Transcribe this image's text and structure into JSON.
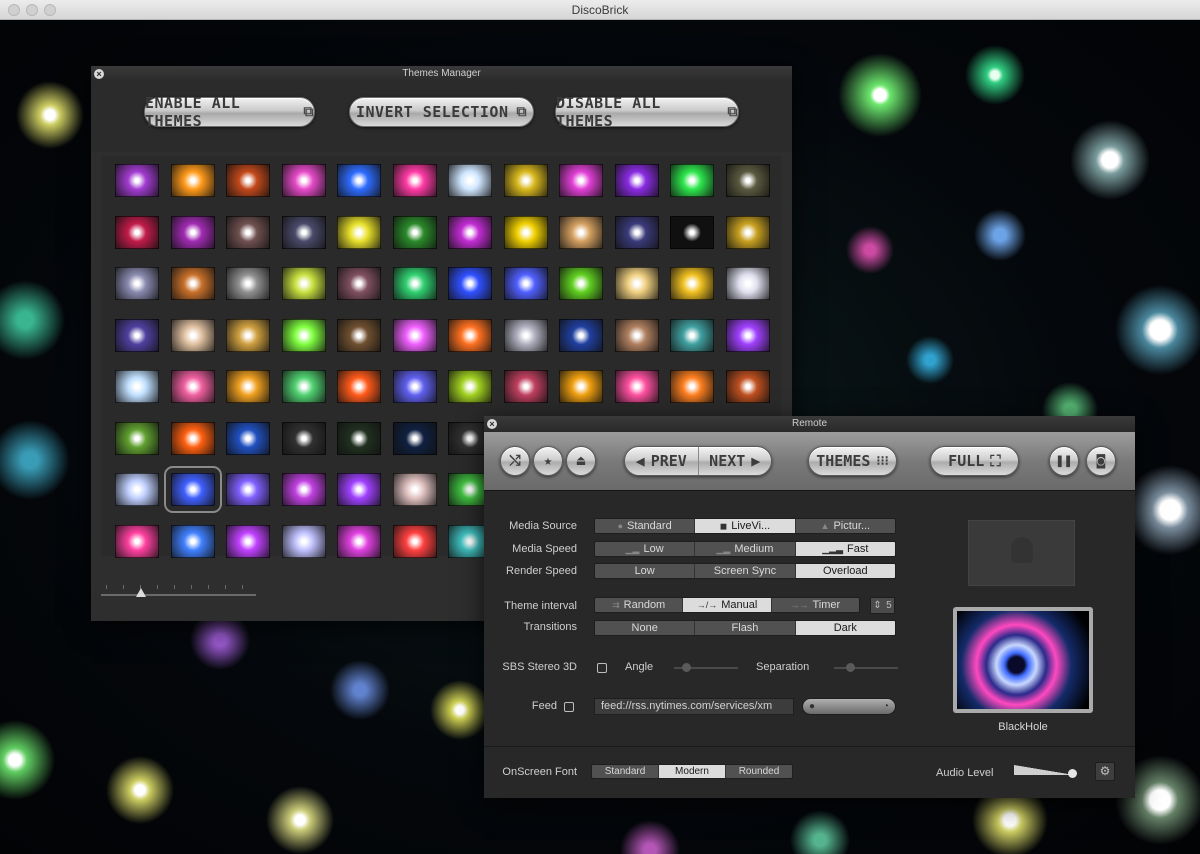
{
  "window": {
    "title": "DiscoBrick"
  },
  "themes_manager": {
    "title": "Themes Manager",
    "buttons": {
      "enable_all": "ENABLE ALL THEMES",
      "invert_selection": "INVERT SELECTION",
      "disable_all": "DISABLE ALL THEMES"
    },
    "thumbnail_colors": [
      [
        "#a23bd1",
        "#ff9a1a",
        "#c2481a",
        "#e64ac8",
        "#2e6cff",
        "#ff3aa5",
        "#cfe6ff",
        "#d8b81d",
        "#e13fd6",
        "#8a2be2",
        "#2de64c",
        "#5a5a40"
      ],
      [
        "#c21b4a",
        "#a12bb3",
        "#705050",
        "#4a4a6a",
        "#e8e02a",
        "#2a8a2a",
        "#c22cd4",
        "#f0d000",
        "#d4a060",
        "#3a3a7a",
        "#101010",
        "#c8a020"
      ],
      [
        "#8a8ab0",
        "#c8702a",
        "#909090",
        "#c8e040",
        "#805060",
        "#30d070",
        "#3050ff",
        "#5060ff",
        "#60d020",
        "#f0d080",
        "#f0c020",
        "#e0e0f0"
      ],
      [
        "#5040a0",
        "#e0c0a0",
        "#d0a040",
        "#80ff40",
        "#705030",
        "#f060ff",
        "#ff7020",
        "#b0b0c0",
        "#2040a0",
        "#b08060",
        "#40a0a0",
        "#a040ff"
      ],
      [
        "#c0e0ff",
        "#f060a0",
        "#f0a020",
        "#50d070",
        "#ff5a1a",
        "#6060f0",
        "#a0d020",
        "#c04060",
        "#f0a010",
        "#ff50a0",
        "#ff8020",
        "#c05020"
      ],
      [
        "#60a030",
        "#ff6010",
        "#2050c0",
        "#303030",
        "#203020",
        "#102040",
        "#303030",
        "#000000",
        "#000000",
        "#000000",
        "#000000",
        "#000000"
      ],
      [
        "#c0d0ff",
        "#4060ff",
        "#8060ff",
        "#c040e0",
        "#a040ff",
        "#e0c0c0",
        "#40c040",
        "#000000",
        "#000000",
        "#000000",
        "#000000",
        "#000000"
      ],
      [
        "#ff40a0",
        "#4080ff",
        "#c040ff",
        "#c0c0ff",
        "#e040e0",
        "#ff4040",
        "#40c0c0",
        "#000000",
        "#000000",
        "#000000",
        "#000000",
        "#000000"
      ]
    ]
  },
  "remote": {
    "title": "Remote",
    "toolbar": {
      "prev": "PREV",
      "next": "NEXT",
      "themes": "THEMES",
      "full": "FULL"
    },
    "media_source": {
      "label": "Media Source",
      "options": [
        "Standard",
        "LiveVi...",
        "Pictur..."
      ],
      "selected": 1
    },
    "media_speed": {
      "label": "Media Speed",
      "options": [
        "Low",
        "Medium",
        "Fast"
      ],
      "selected": 2
    },
    "render_speed": {
      "label": "Render Speed",
      "options": [
        "Low",
        "Screen Sync",
        "Overload"
      ],
      "selected": 2
    },
    "theme_interval": {
      "label": "Theme interval",
      "options": [
        "Random",
        "Manual",
        "Timer"
      ],
      "selected": 1,
      "timer_value": "5"
    },
    "transitions": {
      "label": "Transitions",
      "options": [
        "None",
        "Flash",
        "Dark"
      ],
      "selected": 2
    },
    "stereo": {
      "label": "SBS Stereo 3D",
      "checked": false,
      "angle_label": "Angle",
      "separation_label": "Separation"
    },
    "feed": {
      "label": "Feed",
      "checked": false,
      "url": "feed://rss.nytimes.com/services/xm"
    },
    "preview_name": "BlackHole",
    "onscreen_font": {
      "label": "OnScreen Font",
      "options": [
        "Standard",
        "Modern",
        "Rounded"
      ],
      "selected": 1
    },
    "audio_level": {
      "label": "Audio Level",
      "value": 1.0
    }
  }
}
